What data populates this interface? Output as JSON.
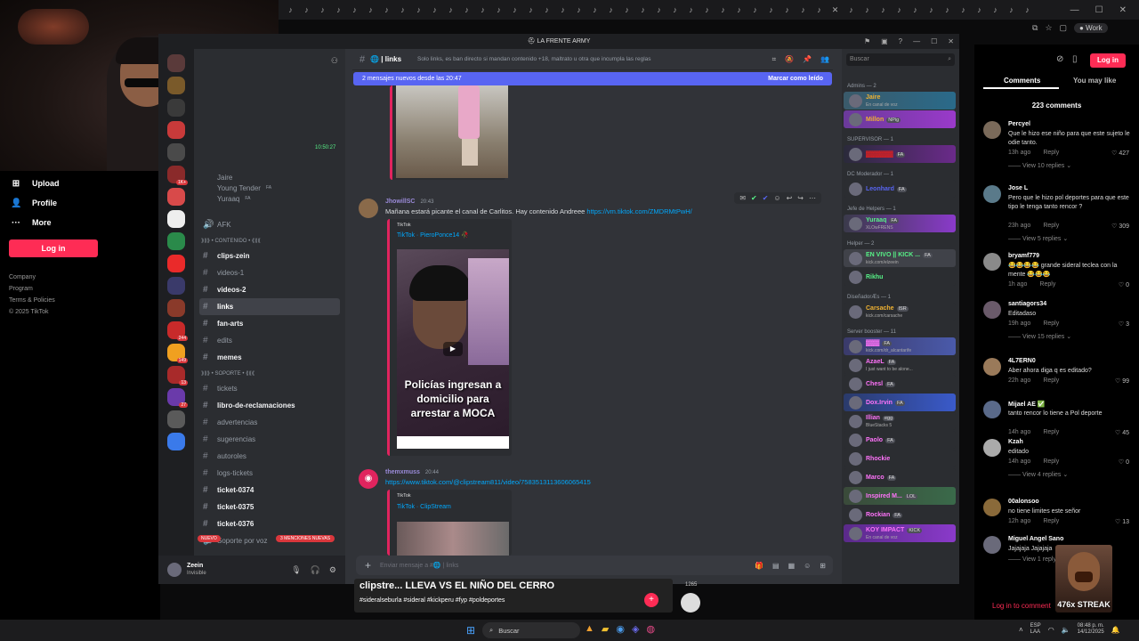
{
  "chrome": {
    "tab_icons": 47,
    "profile_label": "Work",
    "window_controls": [
      "—",
      "☐",
      "✕"
    ]
  },
  "tiktok": {
    "nav": [
      {
        "icon": "upload-icon",
        "label": "Upload"
      },
      {
        "icon": "profile-icon",
        "label": "Profile"
      },
      {
        "icon": "more-icon",
        "label": "More"
      }
    ],
    "login_label": "Log in",
    "footer": [
      "Company",
      "Program",
      "Terms & Policies",
      "© 2025 TikTok"
    ],
    "header_login": "Log in",
    "tabs": [
      "Comments",
      "You may like"
    ],
    "comment_count": "223 comments",
    "comments": [
      {
        "user": "Percyel",
        "text": "Que le hizo ese niño para que este sujeto le odie tanto.",
        "time": "13h ago",
        "reply": "Reply",
        "likes": "427",
        "replies": "View 10 replies",
        "avatar_color": "#7a6a5a"
      },
      {
        "user": "Jose L",
        "text": "Pero que le hizo pol deportes para que este tipo le tenga tanto rencor ?",
        "time": "23h ago",
        "reply": "Reply",
        "likes": "309",
        "replies": "View 5 replies",
        "avatar_color": "#5a7a8a"
      },
      {
        "user": "bryamf779",
        "text": "😂😂😂😂 grande sideral teclea con la mente 😂😂😂",
        "time": "1h ago",
        "reply": "Reply",
        "likes": "0",
        "replies": "",
        "avatar_color": "#8a8a8a"
      },
      {
        "user": "santiagors34",
        "text": "Editadaso",
        "time": "19h ago",
        "reply": "Reply",
        "likes": "3",
        "replies": "View 15 replies",
        "avatar_color": "#6a5a6a"
      },
      {
        "user": "4L7ERN0",
        "text": "Aber ahora diga q es editado?",
        "time": "22h ago",
        "reply": "Reply",
        "likes": "99",
        "replies": "",
        "avatar_color": "#9a7a5a"
      },
      {
        "user": "Mijael AE ✅",
        "text": "tanto rencor lo tiene a Pol deporte",
        "time": "14h ago",
        "reply": "Reply",
        "likes": "45",
        "replies": "",
        "avatar_color": "#5a6a8a"
      },
      {
        "user": "Kzah",
        "text": "editado",
        "time": "14h ago",
        "reply": "Reply",
        "likes": "0",
        "replies": "View 4 replies",
        "avatar_color": "#aaaaaa"
      },
      {
        "user": "00alonsoo",
        "text": "no tiene limites este señor",
        "time": "12h ago",
        "reply": "Reply",
        "likes": "13",
        "replies": "",
        "avatar_color": "#8a6a3a"
      },
      {
        "user": "Miguel Angel Sano",
        "text": "Jajajaja Jajajaja",
        "time": "",
        "reply": "",
        "likes": "",
        "replies": "View 1 reply",
        "avatar_color": "#6a6a7a"
      }
    ],
    "login_to_comment": "Log in to comment",
    "streak": "476x STREAK"
  },
  "discord": {
    "window_title": "LA FRENTE ARMY",
    "timestamp_side": "10:50:27",
    "voice_users": [
      "Jaire",
      "Young Tender",
      "Yuraaq"
    ],
    "voice_tags": [
      "",
      "FA",
      "FA"
    ],
    "channels": [
      {
        "type": "voice",
        "label": "AFK",
        "bold": false
      },
      {
        "type": "category",
        "label": "⟫⟫⟫ • CONTENIDO • ⟪⟪⟪"
      },
      {
        "type": "text",
        "label": "clips-zein",
        "bold": true
      },
      {
        "type": "text",
        "label": "videos-1",
        "bold": false
      },
      {
        "type": "text",
        "label": "videos-2",
        "bold": true
      },
      {
        "type": "text",
        "label": "links",
        "bold": true,
        "active": true
      },
      {
        "type": "text",
        "label": "fan-arts",
        "bold": true
      },
      {
        "type": "text",
        "label": "edits",
        "bold": false
      },
      {
        "type": "text",
        "label": "memes",
        "bold": true
      },
      {
        "type": "category",
        "label": "⟫⟫⟫ • SOPORTE • ⟪⟪⟪"
      },
      {
        "type": "text",
        "label": "tickets",
        "bold": false
      },
      {
        "type": "text",
        "label": "libro-de-reclamaciones",
        "bold": true
      },
      {
        "type": "text",
        "label": "advertencias",
        "bold": false
      },
      {
        "type": "text",
        "label": "sugerencias",
        "bold": false
      },
      {
        "type": "text",
        "label": "autoroles",
        "bold": false
      },
      {
        "type": "text",
        "label": "logs-tickets",
        "bold": false
      },
      {
        "type": "text",
        "label": "ticket-0374",
        "bold": true
      },
      {
        "type": "text",
        "label": "ticket-0375",
        "bold": true
      },
      {
        "type": "text",
        "label": "ticket-0376",
        "bold": true
      },
      {
        "type": "voice",
        "label": "Soporte por voz",
        "bold": false
      }
    ],
    "nuevo_badge": "NUEVO",
    "mentions_badge": "3 MENCIONES NUEVAS",
    "user": {
      "name": "Zeein",
      "status": "Invisible"
    },
    "channel_name": "links",
    "channel_topic": "Solo links, es ban directo si mandan contenido +18, maltrato u otra que incumpla las reglas",
    "new_messages": "2 mensajes nuevos desde las 20:47",
    "mark_read": "Marcar como leído",
    "messages": [
      {
        "user": "JhowillSC",
        "time": "20:43",
        "text": "Mañana estará picante el canal de Carlitos. Hay contenido Andreee",
        "link": "https://vm.tiktok.com/ZMDRMtPwH/",
        "embed_provider": "TikTok",
        "embed_title": "TikTok · PieroPonce14 🥀",
        "thumb_caption": "Policías ingresan a domicilio para arrestar a MOCA"
      },
      {
        "user": "themxmuss",
        "time": "20:44",
        "link": "https://www.tiktok.com/@clipstream811/video/7583513113606065415",
        "embed_provider": "TikTok",
        "embed_title": "TikTok · ClipStream"
      }
    ],
    "input_placeholder": "Enviar mensaje a #🌐 | links",
    "search_placeholder": "Buscar",
    "member_groups": [
      {
        "title": "Admins — 2",
        "members": [
          {
            "name": "Jaire",
            "color": "#f0b232",
            "sub": "En canal de voz",
            "bg": "linear-gradient(90deg,#3a5a6a,#2a6a8a)",
            "tag": ""
          },
          {
            "name": "Millon",
            "color": "#f0b232",
            "sub": "",
            "bg": "linear-gradient(90deg,#6a3a9a,#9a3aca)",
            "tag": "NPig"
          }
        ]
      },
      {
        "title": "SUPERVISOR — 1",
        "members": [
          {
            "name": "▓▓▓▓▓▓",
            "color": "#e02020",
            "sub": "",
            "bg": "linear-gradient(90deg,#2a2a3a,#6a2a8a)",
            "tag": "FA"
          }
        ]
      },
      {
        "title": "DC Moderador — 1",
        "members": [
          {
            "name": "Leonhard",
            "color": "#5865f2",
            "sub": "",
            "bg": "#2b2d31",
            "tag": "FA"
          }
        ]
      },
      {
        "title": "Jefe de Helpers — 1",
        "members": [
          {
            "name": "Yuraaq",
            "color": "#57f287",
            "sub": "XLOwFRENS",
            "bg": "linear-gradient(90deg,#3a3a4a,#8a3aca)",
            "tag": "FA"
          }
        ]
      },
      {
        "title": "Helper — 2",
        "members": [
          {
            "name": "EN VIVO || KICK ...",
            "color": "#57f287",
            "sub": "kick.com/elzeein",
            "bg": "#404249",
            "tag": "FA"
          },
          {
            "name": "Rikhu",
            "color": "#57f287",
            "sub": "",
            "bg": "#2b2d31",
            "tag": ""
          }
        ]
      },
      {
        "title": "DiseñadorÆs — 1",
        "members": [
          {
            "name": "Carsache",
            "color": "#f0b232",
            "sub": "kick.com/carsache",
            "bg": "#2b2d31",
            "tag": "ISR"
          }
        ]
      },
      {
        "title": "Server booster — 11",
        "members": [
          {
            "name": "▓▓▓",
            "color": "#ff73fa",
            "sub": "kick.com/dr_alcantarife",
            "bg": "linear-gradient(90deg,#3a3a6a,#4a5aaa)",
            "tag": "FA"
          },
          {
            "name": "AzaeL",
            "color": "#ff73fa",
            "sub": "I just want to be alone...",
            "bg": "#2b2d31",
            "tag": "FA"
          },
          {
            "name": "Chesl",
            "color": "#ff73fa",
            "sub": "",
            "bg": "#2b2d31",
            "tag": "FA"
          },
          {
            "name": "Dox.Irvin",
            "color": "#ff73fa",
            "sub": "",
            "bg": "linear-gradient(90deg,#2a3a6a,#3a5aca)",
            "tag": "FA"
          },
          {
            "name": "Illian",
            "color": "#ff73fa",
            "sub": "BlueStacks 5",
            "bg": "#2b2d31",
            "tag": "egg"
          },
          {
            "name": "Paolo",
            "color": "#ff73fa",
            "sub": "",
            "bg": "#2b2d31",
            "tag": "FA"
          },
          {
            "name": "Rhockie",
            "color": "#ff73fa",
            "sub": "",
            "bg": "#2b2d31",
            "tag": ""
          },
          {
            "name": "Marco",
            "color": "#ff73fa",
            "sub": "",
            "bg": "#2b2d31",
            "tag": "FA"
          },
          {
            "name": "Inspired M...",
            "color": "#ff73fa",
            "sub": "",
            "bg": "linear-gradient(90deg,#3a4a3a,#3a6a4a)",
            "tag": "LOL"
          },
          {
            "name": "Rockian",
            "color": "#ff73fa",
            "sub": "",
            "bg": "#2b2d31",
            "tag": "FA"
          },
          {
            "name": "KOY IMPACT",
            "color": "#ff73fa",
            "sub": "En canal de voz",
            "bg": "linear-gradient(90deg,#5a2a8a,#8a3aca)",
            "tag": "KICK"
          }
        ]
      }
    ]
  },
  "video": {
    "caption": "clipstre... LLEVA VS EL NIÑO DEL CERRO",
    "hashtags": "#sideralseburla #sideral #kickperu #fyp #poldeportes",
    "side_count": "1265"
  },
  "taskbar": {
    "search": "Buscar",
    "lang": "ESP\nLAA",
    "time": "08:48 p. m.",
    "date": "14/12/2025"
  }
}
